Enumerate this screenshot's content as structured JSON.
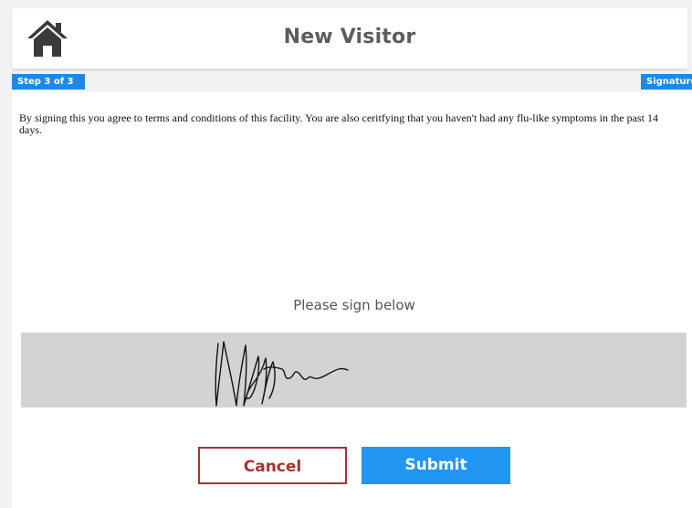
{
  "header": {
    "title": "New Visitor",
    "home_icon": "home-icon"
  },
  "steps": {
    "progress": "Step 3 of 3",
    "current_section": "Signature"
  },
  "agreement": {
    "text": "By signing this you agree to terms and conditions of this facility. You are also ceritfying that you haven't had any flu-like symptoms in the past 14 days."
  },
  "signature": {
    "prompt": "Please sign below",
    "signed": true
  },
  "actions": {
    "cancel_label": "Cancel",
    "submit_label": "Submit"
  },
  "colors": {
    "accent": "#2196f3",
    "step_pill": "#1e88e5",
    "cancel": "#a83232",
    "pad": "#d3d3d3"
  }
}
